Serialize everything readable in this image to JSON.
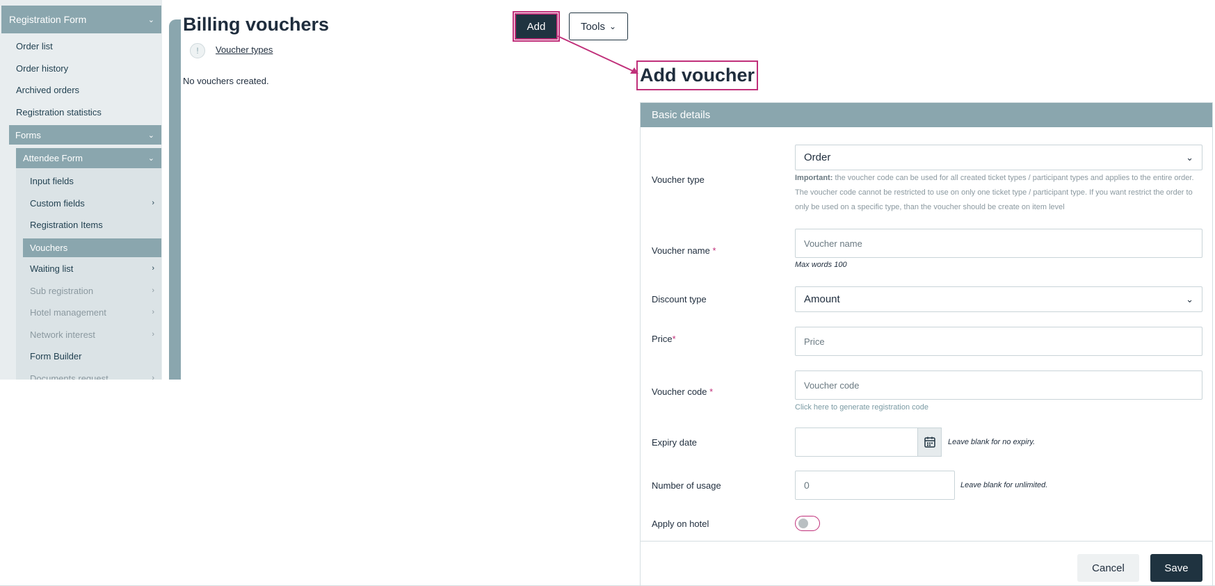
{
  "sidebar": {
    "header": "Registration Form",
    "links": [
      "Order list",
      "Order history",
      "Archived orders",
      "Registration statistics"
    ],
    "forms": "Forms",
    "attendee_form": "Attendee Form",
    "sub_items": {
      "input_fields": "Input fields",
      "custom_fields": "Custom fields",
      "registration_items": "Registration Items",
      "vouchers": "Vouchers",
      "waiting_list": "Waiting list",
      "sub_registration": "Sub registration",
      "hotel_management": "Hotel management",
      "network_interest": "Network interest",
      "form_builder": "Form Builder",
      "documents_request": "Documents request"
    }
  },
  "main": {
    "title": "Billing vouchers",
    "voucher_types_link": "Voucher types",
    "empty_text": "No vouchers created."
  },
  "toolbar": {
    "add_label": "Add",
    "tools_label": "Tools"
  },
  "modal": {
    "title": "Add voucher",
    "section": "Basic details",
    "voucher_type": {
      "label": "Voucher type",
      "value": "Order",
      "note_bold": "Important:",
      "note": " the voucher code can be used for all created ticket types / participant types and applies to the entire order. The voucher code cannot be restricted to use on only one ticket type / participant type. If you want restrict the order to only be used on a specific type, than the voucher should be create on item level"
    },
    "voucher_name": {
      "label": "Voucher name ",
      "required": "*",
      "placeholder": "Voucher name",
      "help": "Max words 100"
    },
    "discount_type": {
      "label": "Discount type",
      "value": "Amount"
    },
    "price": {
      "label": "Price",
      "required": "*",
      "placeholder": "Price"
    },
    "voucher_code": {
      "label": "Voucher code ",
      "required": "*",
      "placeholder": "Voucher code",
      "generate_link": "Click here to generate registration code"
    },
    "expiry_date": {
      "label": "Expiry date",
      "value": "",
      "note": "Leave blank for no expiry."
    },
    "usage": {
      "label": "Number of usage",
      "value": "0",
      "note": "Leave blank for unlimited."
    },
    "apply_hotel": {
      "label": "Apply on hotel",
      "enabled": false
    },
    "cancel_label": "Cancel",
    "save_label": "Save"
  },
  "colors": {
    "accent": "#8aa6ae",
    "primary": "#1f3340",
    "highlight": "#c0307a"
  }
}
